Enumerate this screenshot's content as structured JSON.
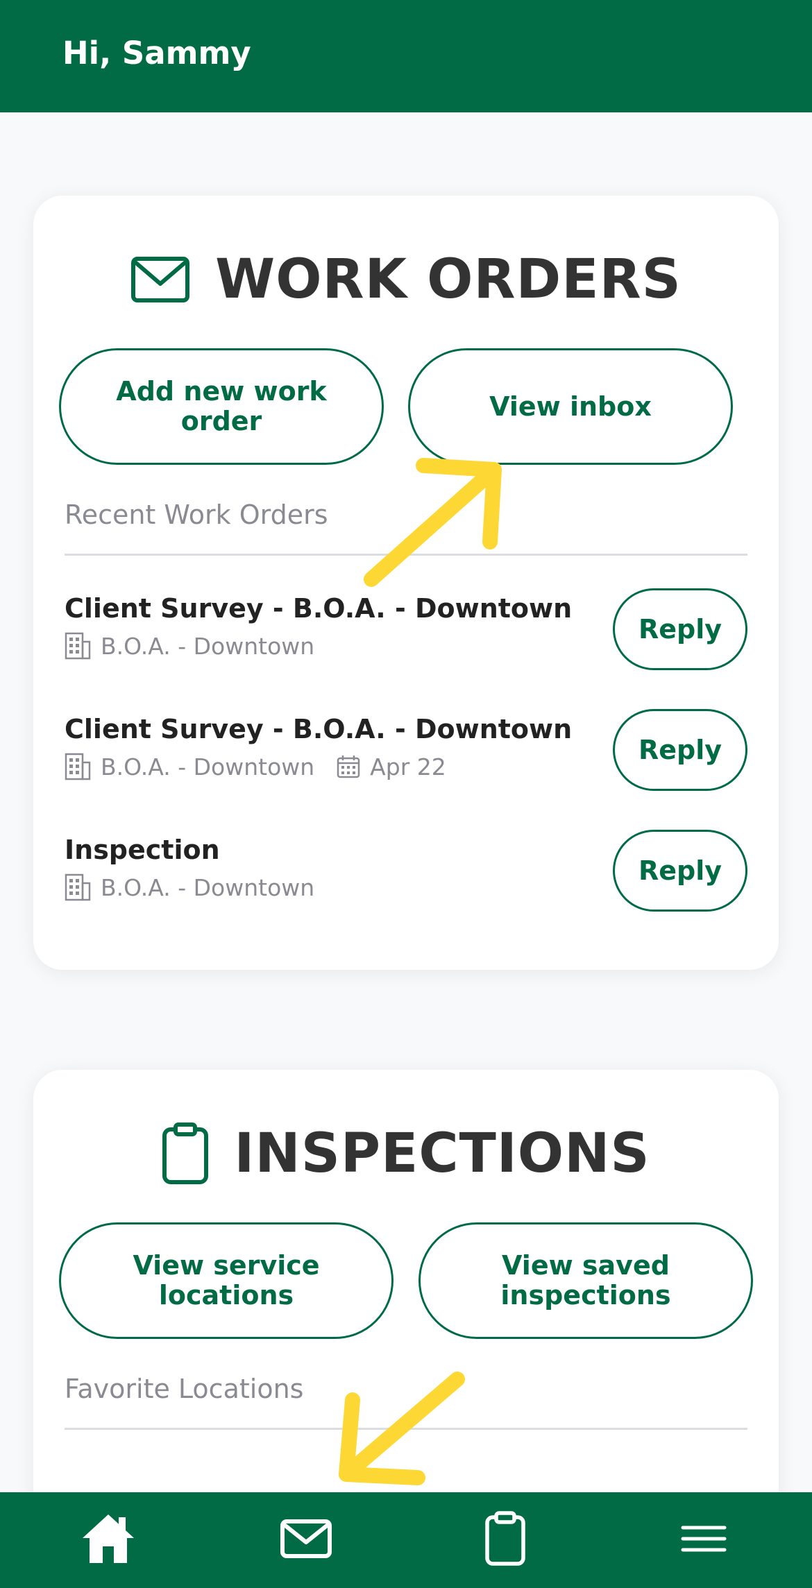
{
  "header": {
    "greeting": "Hi, Sammy"
  },
  "work_orders": {
    "title": "WORK ORDERS",
    "title_icon": "envelope-icon",
    "add_button": "Add new work order",
    "inbox_button": "View inbox",
    "recent_label": "Recent Work Orders",
    "items": [
      {
        "title": "Client Survey - B.O.A. - Downtown",
        "location": "B.O.A. - Downtown",
        "date": "",
        "action": "Reply"
      },
      {
        "title": "Client Survey - B.O.A. - Downtown",
        "location": "B.O.A. - Downtown",
        "date": "Apr 22",
        "action": "Reply"
      },
      {
        "title": "Inspection",
        "location": "B.O.A. - Downtown",
        "date": "",
        "action": "Reply"
      }
    ]
  },
  "inspections": {
    "title": "INSPECTIONS",
    "title_icon": "clipboard-icon",
    "service_locations_button": "View service locations",
    "saved_inspections_button": "View saved inspections",
    "favorites_label": "Favorite Locations"
  },
  "bottom_nav": {
    "items": [
      {
        "icon": "home-icon"
      },
      {
        "icon": "envelope-icon"
      },
      {
        "icon": "clipboard-icon"
      },
      {
        "icon": "menu-icon"
      }
    ]
  },
  "colors": {
    "brand_green": "#006b45",
    "annotation_yellow": "#fdd835",
    "background": "#f8f9fb"
  }
}
